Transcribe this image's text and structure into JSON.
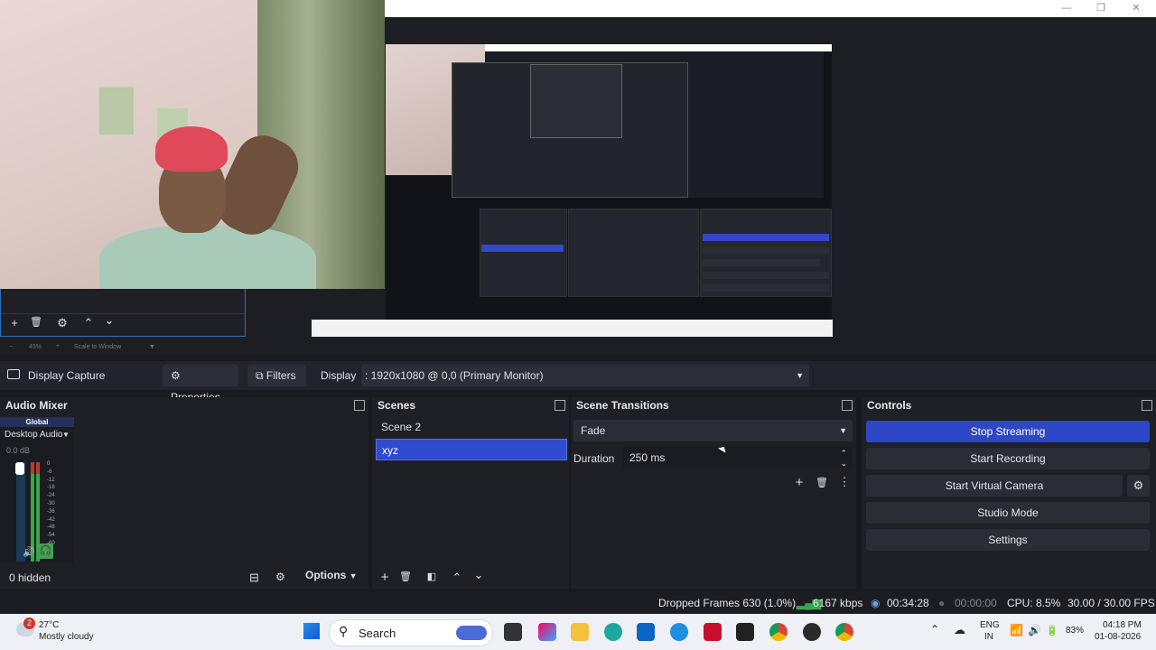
{
  "window": {
    "min": "—",
    "max": "❐",
    "close": "✕"
  },
  "source_controls": {
    "add": "+",
    "remove": "🗑",
    "settings": "⚙",
    "up": "⌃",
    "down": "⌄"
  },
  "zoom": {
    "zoom_out": "−",
    "level": "45%",
    "zoom_in": "+",
    "scale": "Scale to Window",
    "menu": "▼"
  },
  "source_toolbar": {
    "source_name": "Display Capture",
    "properties": "Properties",
    "filters": "Filters",
    "display_label": "Display",
    "display_value": ": 1920x1080 @ 0,0 (Primary Monitor)"
  },
  "audio_mixer": {
    "title": "Audio Mixer",
    "global": "Global",
    "device": "Desktop Audio",
    "level": "0.0 dB",
    "scale": [
      "0",
      "-6",
      "-12",
      "-18",
      "-24",
      "-30",
      "-36",
      "-42",
      "-48",
      "-54",
      "-60"
    ],
    "hidden": "0 hidden",
    "options": "Options"
  },
  "scenes": {
    "title": "Scenes",
    "items": [
      "Scene 2",
      "xyz"
    ]
  },
  "transitions": {
    "title": "Scene Transitions",
    "transition": "Fade",
    "duration_label": "Duration",
    "duration_value": "250 ms"
  },
  "controls": {
    "title": "Controls",
    "stop_streaming": "Stop Streaming",
    "start_recording": "Start Recording",
    "start_virtual_camera": "Start Virtual Camera",
    "studio_mode": "Studio Mode",
    "settings": "Settings"
  },
  "status": {
    "dropped_frames": "Dropped Frames 630 (1.0%)",
    "bitrate": "6167 kbps",
    "stream_time": "00:34:28",
    "rec_time": "00:00:00",
    "cpu": "CPU: 8.5%",
    "fps": "30.00 / 30.00 FPS"
  },
  "taskbar": {
    "weather_badge": "2",
    "temperature": "27°C",
    "weather": "Mostly cloudy",
    "search": "Search",
    "lang1": "ENG",
    "lang2": "IN",
    "battery": "83%",
    "time": "04:18 PM",
    "date": "01-08-2026"
  },
  "colors": {
    "accent": "#2e47c6",
    "meter_green": "#3aa84a",
    "meter_red": "#c0392b"
  }
}
